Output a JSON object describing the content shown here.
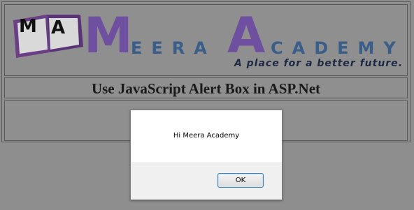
{
  "header": {
    "logo_initials": [
      "M",
      "A"
    ],
    "brand_letters": [
      "M",
      "EERA",
      "A",
      "CADEMY"
    ],
    "tagline": "A place for a better future."
  },
  "title": "Use JavaScript Alert Box in ASP.Net",
  "alert": {
    "message": "Hi Meera Academy",
    "ok_label": "OK"
  },
  "colors": {
    "brand_purple": "#6f4fa0",
    "brand_blue": "#3a5e8a",
    "page_background": "#8e8e8e"
  }
}
